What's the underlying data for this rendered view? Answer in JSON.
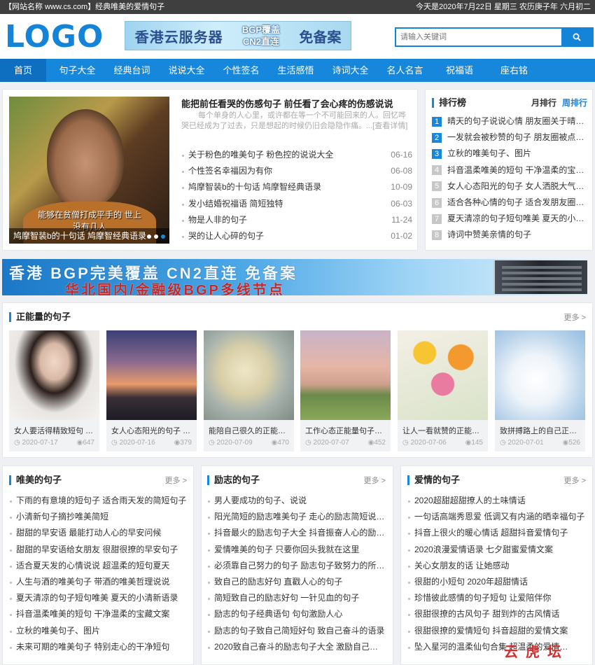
{
  "topbar": {
    "left": "【网站名称 www.cs.com】经典唯美的爱情句子",
    "right": "今天是2020年7月22日 星期三 农历庚子年 六月初二"
  },
  "header": {
    "logo": "LOGO",
    "banner": {
      "line1": "香港云服务器",
      "line2a": "BGP覆盖",
      "line2b": "CN2直连",
      "line3": "免备案"
    },
    "search_placeholder": "请输入关键词"
  },
  "nav": [
    "首页",
    "句子大全",
    "经典台词",
    "说说大全",
    "个性签名",
    "生活感悟",
    "诗词大全",
    "名人名言",
    "祝福语",
    "座右铭"
  ],
  "focus": {
    "caption": "鸠摩智装b的十句话 鸠摩智经典语录",
    "subtitle": "能够在贫僧打成平手的 世上没有几人"
  },
  "headline": {
    "title": "能把前任看哭的伤感句子 前任看了会心疼的伤感说说",
    "desc": "每个单身的人心里，或许都在等一个不可能回来的人。回忆哗哭已经成为了过去，只是想起的时候仍旧会隐隐作痛。...[查看详情]",
    "news": [
      {
        "title": "关于粉色的唯美句子 粉色控的说说大全",
        "date": "06-16"
      },
      {
        "title": "个性签名幸福因为有你",
        "date": "06-08"
      },
      {
        "title": "鸠摩智装b的十句话 鸠摩智经典语录",
        "date": "10-09"
      },
      {
        "title": "发小结婚祝福语 简短独特",
        "date": "06-03"
      },
      {
        "title": "物是人非的句子",
        "date": "11-24"
      },
      {
        "title": "哭的让人心碎的句子",
        "date": "01-02"
      }
    ]
  },
  "ranking": {
    "title": "排行榜",
    "tab_month": "月排行",
    "tab_week": "周排行",
    "items": [
      {
        "n": "1",
        "t": "晴天的句子说说心情 朋友圈关于晴天…"
      },
      {
        "n": "2",
        "t": "一发就会被秒赞的句子 朋友圈被点赞…"
      },
      {
        "n": "3",
        "t": "立秋的唯美句子、图片"
      },
      {
        "n": "4",
        "t": "抖音温柔唯美的短句 干净温柔的宝藏…"
      },
      {
        "n": "5",
        "t": "女人心态阳光的句子 女人洒脱大气的…"
      },
      {
        "n": "6",
        "t": "适合各种心情的句子 适合发朋友圈的…"
      },
      {
        "n": "7",
        "t": "夏天清凉的句子短句唯美 夏天的小清…"
      },
      {
        "n": "8",
        "t": "诗词中赞美亲情的句子"
      }
    ]
  },
  "ad": {
    "line1": "香港 BGP完美覆盖 CN2直连 免备案",
    "line2": "华北国内/金融级BGP多线节点"
  },
  "positive": {
    "title": "正能量的句子",
    "more": "更多 >",
    "cards": [
      {
        "title": "女人要活得精致短句 …",
        "date": "2020-07-17",
        "views": "647"
      },
      {
        "title": "女人心态阳光的句子 …",
        "date": "2020-07-16",
        "views": "379"
      },
      {
        "title": "能陪自己很久的正能…",
        "date": "2020-07-09",
        "views": "470"
      },
      {
        "title": "工作心态正能量句子…",
        "date": "2020-07-07",
        "views": "452"
      },
      {
        "title": "让人一看就赞的正能…",
        "date": "2020-07-06",
        "views": "145"
      },
      {
        "title": "致拼搏路上的自己正…",
        "date": "2020-07-01",
        "views": "526"
      }
    ]
  },
  "columns": [
    {
      "title": "唯美的句子",
      "more": "更多 >",
      "items": [
        "下雨的有意境的短句子 适合雨天发的简短句子",
        "小清新句子摘抄唯美简短",
        "甜甜的早安语 最能打动人心的早安问候",
        "甜甜的早安语给女朋友 很甜很撩的早安句子",
        "适合夏天发的心情说说 超温柔的短句夏天",
        "人生与酒的唯美句子 带酒的唯美哲理说说",
        "夏天清凉的句子短句唯美 夏天的小清新语录",
        "抖音温柔唯美的短句 干净温柔的宝藏文案",
        "立秋的唯美句子、图片",
        "未来可期的唯美句子 特别走心的干净短句"
      ]
    },
    {
      "title": "励志的句子",
      "more": "更多 >",
      "items": [
        "男人要成功的句子、说说",
        "阳光简短的励志唯美句子 走心的励志简短说说…",
        "抖音最火的励志句子大全 抖音振奋人心的励志…",
        "爱情唯美的句子 只要你回头我就在这里",
        "必须靠自己努力的句子 励志句子致努力的所有人",
        "致自己的励志好句 直戳人心的句子",
        "简短致自己的励志好句 一针见血的句子",
        "励志的句子经典语句 句句激励人心",
        "励志的句子致自己简短好句 致自己奋斗的语录",
        "2020致自己奋斗的励志句子大全 激励自己的经…"
      ]
    },
    {
      "title": "爱情的句子",
      "more": "更多 >",
      "items": [
        "2020超甜超甜撩人的土味情话",
        "一句话高端秀恩爱 低调又有内涵的晒幸福句子",
        "抖音上很火的暖心情话 超甜抖音爱情句子",
        "2020浪漫爱情语录 七夕甜蜜爱情文案",
        "关心女朋友的话 让她感动",
        "很甜的小短句 2020年超甜情话",
        "珍惜彼此感情的句子短句 让爱陪伴你",
        "很甜很撩的古风句子 甜到炸的古风情话",
        "很甜很撩的爱情短句 抖音超甜的爱情文案",
        "坠入星河的温柔仙句合集 超温柔的爱情…"
      ]
    }
  ],
  "watermark": "云 虎 坛",
  "colors": {
    "accent": "#1787dc",
    "nav_active": "#0e6fc0",
    "topbar": "#3f3f3f"
  }
}
